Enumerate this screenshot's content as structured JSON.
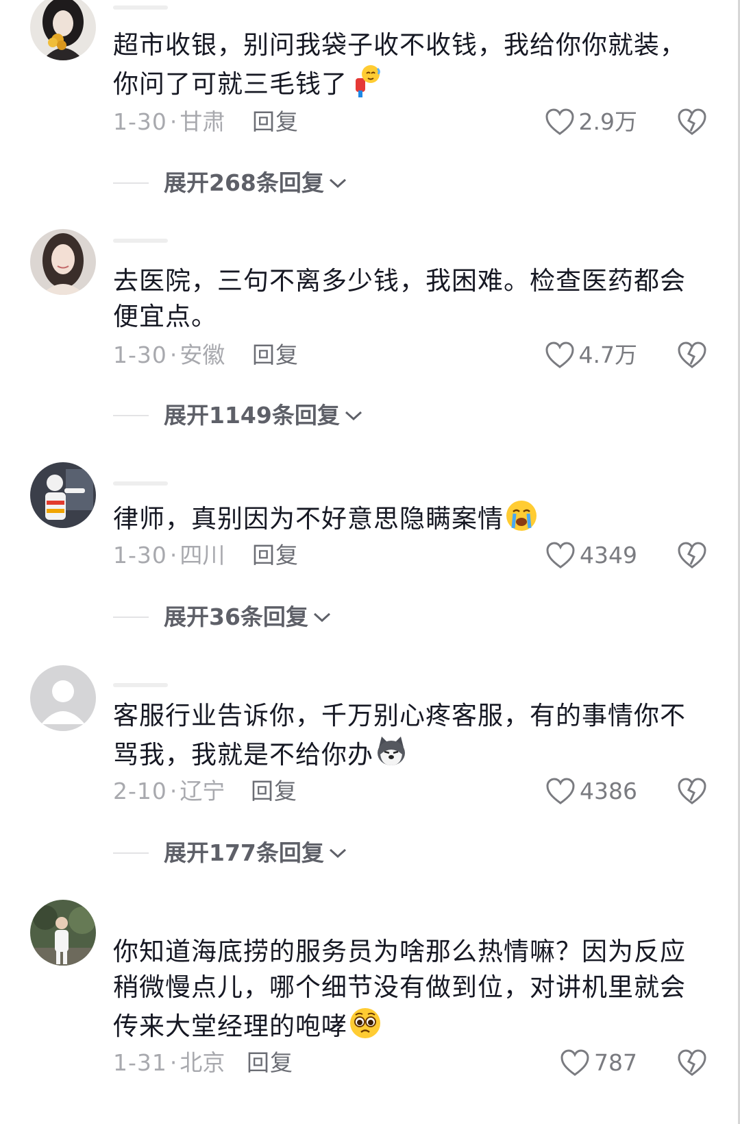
{
  "comments": [
    {
      "text": "超市收银，别问我袋子收不收钱，我给你你就装，你问了可就三毛钱了",
      "date": "1-30",
      "location": "甘肃",
      "reply_label": "回复",
      "likes": "2.9万",
      "expand_label": "展开268条回复",
      "avatar_icon": "woman-with-flower-avatar",
      "emoji_icon": "bowing-emoji"
    },
    {
      "text": "去医院，三句不离多少钱，我困难。检查医药都会便宜点。",
      "date": "1-30",
      "location": "安徽",
      "reply_label": "回复",
      "likes": "4.7万",
      "expand_label": "展开1149条回复",
      "avatar_icon": "woman-portrait-avatar"
    },
    {
      "text": "律师，真别因为不好意思隐瞒案情",
      "date": "1-30",
      "location": "四川",
      "reply_label": "回复",
      "likes": "4349",
      "expand_label": "展开36条回复",
      "avatar_icon": "traffic-police-avatar",
      "emoji_icon": "crying-emoji"
    },
    {
      "text": "客服行业告诉你，千万别心疼客服，有的事情你不骂我，我就是不给你办",
      "date": "2-10",
      "location": "辽宁",
      "reply_label": "回复",
      "likes": "4386",
      "expand_label": "展开177条回复",
      "avatar_icon": "default-user-avatar",
      "emoji_icon": "husky-dog-emoji"
    },
    {
      "text": "你知道海底捞的服务员为啥那么热情嘛？因为反应稍微慢点儿，哪个细节没有做到位，对讲机里就会传来大堂经理的咆哮",
      "date": "1-31",
      "location": "北京",
      "reply_label": "回复",
      "likes": "787",
      "avatar_icon": "man-outdoor-avatar",
      "emoji_icon": "pleading-emoji"
    }
  ],
  "colors": {
    "text": "#161823",
    "meta": "#a8a9ae",
    "reply": "#6b6d74",
    "expand": "#5e6068"
  }
}
